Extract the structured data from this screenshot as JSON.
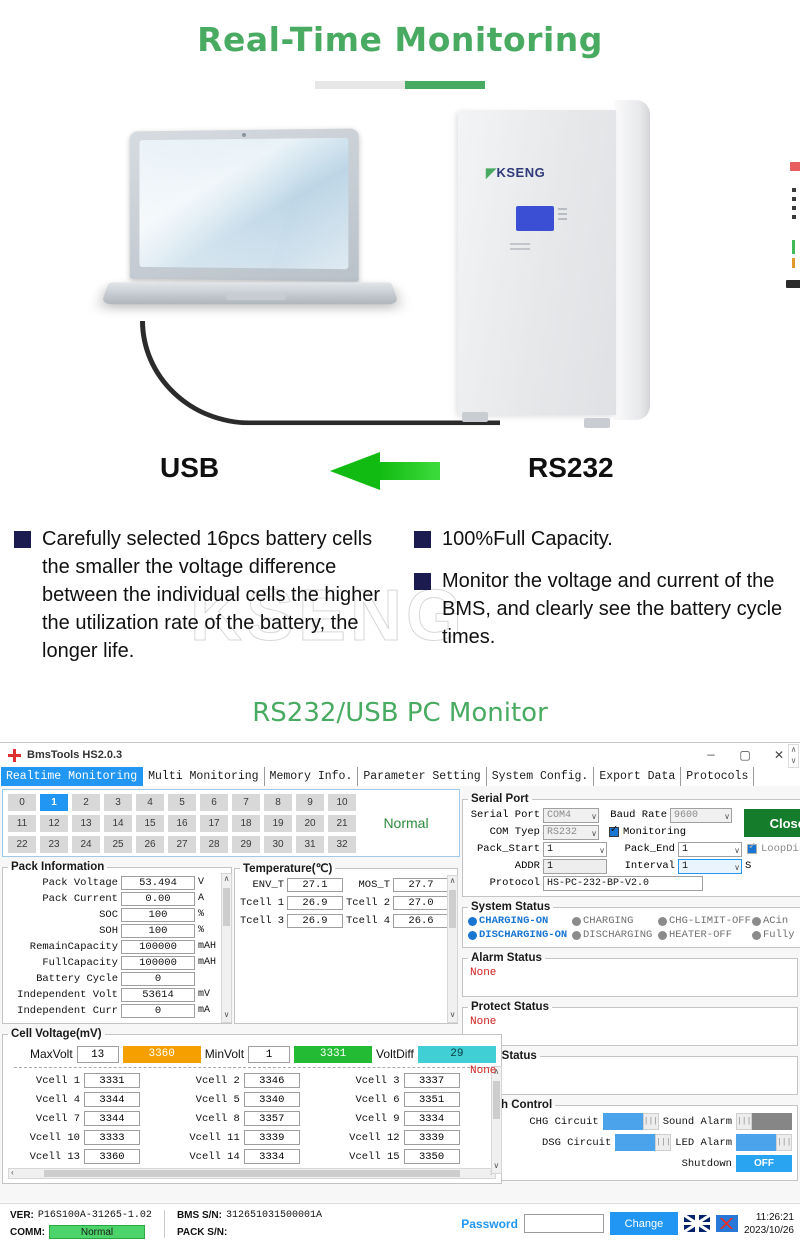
{
  "hero": {
    "title": "Real-Time Monitoring",
    "label_usb": "USB",
    "label_rs232": "RS232",
    "cabinet_brand": "KSENG",
    "watermark": "KSENG",
    "subtitle": "RS232/USB PC Monitor",
    "bullets_left": [
      "Carefully selected 16pcs battery cells the smaller the voltage difference between the individual cells the higher the utilization rate of the battery, the longer life."
    ],
    "bullets_right": [
      "100%Full Capacity.",
      "Monitor the voltage and current of the BMS, and clearly see the battery cycle times."
    ]
  },
  "window": {
    "title": "BmsTools HS2.0.3",
    "icon": "app-icon",
    "controls": {
      "minimize": "—",
      "maximize": "▢",
      "close": "✕"
    },
    "tabs": [
      {
        "label": "Realtime Monitoring",
        "active": true
      },
      {
        "label": "Multi Monitoring",
        "active": false
      },
      {
        "label": "Memory Info.",
        "active": false
      },
      {
        "label": "Parameter Setting",
        "active": false
      },
      {
        "label": "System Config.",
        "active": false
      },
      {
        "label": "Export Data",
        "active": false
      },
      {
        "label": "Protocols",
        "active": false
      }
    ]
  },
  "pack_selector": {
    "rows": [
      [
        "0",
        "1",
        "2",
        "3",
        "4",
        "5",
        "6",
        "7",
        "8",
        "9",
        "10"
      ],
      [
        "11",
        "12",
        "13",
        "14",
        "15",
        "16",
        "17",
        "18",
        "19",
        "20",
        "21"
      ],
      [
        "22",
        "23",
        "24",
        "25",
        "26",
        "27",
        "28",
        "29",
        "30",
        "31",
        "32"
      ]
    ],
    "selected": "1",
    "status": "Normal"
  },
  "pack_information": {
    "legend": "Pack Information",
    "rows": [
      {
        "label": "Pack Voltage",
        "value": "53.494",
        "unit": "V"
      },
      {
        "label": "Pack Current",
        "value": "0.00",
        "unit": "A"
      },
      {
        "label": "SOC",
        "value": "100",
        "unit": "%"
      },
      {
        "label": "SOH",
        "value": "100",
        "unit": "%"
      },
      {
        "label": "RemainCapacity",
        "value": "100000",
        "unit": "mAH"
      },
      {
        "label": "FullCapacity",
        "value": "100000",
        "unit": "mAH"
      },
      {
        "label": "Battery Cycle",
        "value": "0",
        "unit": ""
      },
      {
        "label": "Independent Volt",
        "value": "53614",
        "unit": "mV"
      },
      {
        "label": "Independent Curr",
        "value": "0",
        "unit": "mA"
      }
    ]
  },
  "temperature": {
    "legend": "Temperature(℃)",
    "rows": [
      [
        {
          "label": "ENV_T",
          "value": "27.1"
        },
        {
          "label": "MOS_T",
          "value": "27.7"
        }
      ],
      [
        {
          "label": "Tcell 1",
          "value": "26.9"
        },
        {
          "label": "Tcell 2",
          "value": "27.0"
        }
      ],
      [
        {
          "label": "Tcell 3",
          "value": "26.9"
        },
        {
          "label": "Tcell 4",
          "value": "26.6"
        }
      ]
    ]
  },
  "cell_voltage": {
    "legend": "Cell Voltage(mV)",
    "max_label": "MaxVolt",
    "max_index": "13",
    "max_value": "3360",
    "max_color": "#f5a000",
    "min_label": "MinVolt",
    "min_index": "1",
    "min_value": "3331",
    "min_color": "#22bb33",
    "diff_label": "VoltDiff",
    "diff_value": "29",
    "diff_color": "#3fcfd5",
    "cells": [
      {
        "label": "Vcell 1",
        "value": "3331"
      },
      {
        "label": "Vcell 2",
        "value": "3346"
      },
      {
        "label": "Vcell 3",
        "value": "3337"
      },
      {
        "label": "Vcell 4",
        "value": "3344"
      },
      {
        "label": "Vcell 5",
        "value": "3340"
      },
      {
        "label": "Vcell 6",
        "value": "3351"
      },
      {
        "label": "Vcell 7",
        "value": "3344"
      },
      {
        "label": "Vcell 8",
        "value": "3357"
      },
      {
        "label": "Vcell 9",
        "value": "3334"
      },
      {
        "label": "Vcell 10",
        "value": "3333"
      },
      {
        "label": "Vcell 11",
        "value": "3339"
      },
      {
        "label": "Vcell 12",
        "value": "3339"
      },
      {
        "label": "Vcell 13",
        "value": "3360"
      },
      {
        "label": "Vcell 14",
        "value": "3334"
      },
      {
        "label": "Vcell 15",
        "value": "3350"
      }
    ]
  },
  "serial_port": {
    "legend": "Serial Port",
    "serial_port_label": "Serial Port",
    "serial_port_value": "COM4",
    "baud_rate_label": "Baud Rate",
    "baud_rate_value": "9600",
    "com_type_label": "COM Tyep",
    "com_type_value": "RS232",
    "monitoring_label": "Monitoring",
    "monitoring_checked": true,
    "pack_start_label": "Pack_Start",
    "pack_start_value": "1",
    "pack_end_label": "Pack_End",
    "pack_end_value": "1",
    "loop_display_label": "LoopDisplay",
    "loop_display_checked": true,
    "addr_label": "ADDR",
    "addr_value": "1",
    "interval_label": "Interval",
    "interval_value": "1",
    "interval_unit": "S",
    "protocol_label": "Protocol",
    "protocol_value": "HS-PC-232-BP-V2.0",
    "close_button": "Close"
  },
  "system_status": {
    "legend": "System Status",
    "row1": [
      {
        "label": "CHARGING-ON",
        "state": "on"
      },
      {
        "label": "CHARGING",
        "state": "off"
      },
      {
        "label": "CHG-LIMIT-OFF",
        "state": "off"
      },
      {
        "label": "ACin",
        "state": "off"
      }
    ],
    "row2": [
      {
        "label": "DISCHARGING-ON",
        "state": "on"
      },
      {
        "label": "DISCHARGING",
        "state": "off"
      },
      {
        "label": "HEATER-OFF",
        "state": "off"
      },
      {
        "label": "Fully",
        "state": "off"
      }
    ]
  },
  "alarm_status": {
    "legend": "Alarm Status",
    "value": "None"
  },
  "protect_status": {
    "legend": "Protect Status",
    "value": "None"
  },
  "fault_status": {
    "legend": "Fault Status",
    "value": "None"
  },
  "switch_control": {
    "legend": "Switch Control",
    "chg_circuit_label": "CHG Circuit",
    "chg_circuit_on": true,
    "sound_alarm_label": "Sound Alarm",
    "sound_alarm_on": false,
    "dsg_circuit_label": "DSG Circuit",
    "dsg_circuit_on": true,
    "led_alarm_label": "LED Alarm",
    "led_alarm_on": true,
    "shutdown_label": "Shutdown",
    "shutdown_state": "OFF"
  },
  "status_bar": {
    "ver_label": "VER:",
    "ver_value": "P16S100A-31265-1.02",
    "comm_label": "COMM:",
    "comm_value": "Normal",
    "bms_sn_label": "BMS S/N:",
    "bms_sn_value": "312651031500001A",
    "pack_sn_label": "PACK S/N:",
    "pack_sn_value": "",
    "password_label": "Password",
    "password_value": "",
    "change_button": "Change",
    "time": "11:26:21",
    "date": "2023/10/26"
  }
}
